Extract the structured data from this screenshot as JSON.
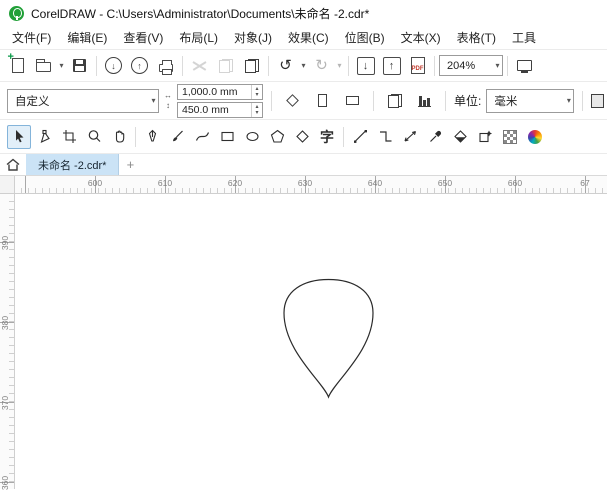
{
  "window": {
    "title": "CorelDRAW - C:\\Users\\Administrator\\Documents\\未命名 -2.cdr*"
  },
  "menu": {
    "items": [
      "文件(F)",
      "编辑(E)",
      "查看(V)",
      "布局(L)",
      "对象(J)",
      "效果(C)",
      "位图(B)",
      "文本(X)",
      "表格(T)",
      "工具"
    ]
  },
  "standard_toolbar": {
    "zoom_level": "204%",
    "pdf_label": "PDF",
    "buttons": [
      "new-document",
      "open",
      "save",
      "open-from-cloud",
      "save-to-cloud",
      "print",
      "cut",
      "copy",
      "paste",
      "undo",
      "redo",
      "import",
      "export",
      "publish-to-pdf",
      "zoom-levels",
      "fullscreen-preview"
    ]
  },
  "property_bar": {
    "page_preset": "自定义",
    "page_width": "1,000.0 mm",
    "page_height": "450.0 mm",
    "units_label": "单位:",
    "units_value": "毫米"
  },
  "toolbox": {
    "tools": [
      "pick-tool",
      "shape-tool",
      "crop-tool",
      "zoom-tool",
      "pan-tool",
      "freehand-tool",
      "artistic-media-tool",
      "bezier-tool",
      "rectangle-tool",
      "ellipse-tool",
      "polygon-tool",
      "common-shapes-tool",
      "text-tool",
      "line-tool",
      "connector-tool",
      "dimension-tool",
      "eyedropper-tool",
      "interactive-fill-tool",
      "smart-fill-tool",
      "transparency-tool",
      "more-tools"
    ],
    "active_tool": "pick-tool"
  },
  "doc_tabs": {
    "active_tab": "未命名 -2.cdr*",
    "new_tab_label": "+"
  },
  "rulers": {
    "h_labels": [
      "600",
      "610",
      "620",
      "630",
      "640",
      "650",
      "660",
      "67"
    ],
    "v_labels": [
      "390",
      "380",
      "370",
      "360"
    ]
  },
  "icons": {
    "dropdown_arrow": "▾",
    "spinner_up": "▴",
    "spinner_down": "▾",
    "undo_glyph": "↺",
    "redo_glyph": "↻",
    "down_arrow": "↓",
    "up_arrow": "↑",
    "plus": "+",
    "width_arrow": "↔",
    "height_arrow": "↕",
    "text_tool_glyph": "字",
    "home": "house-shape",
    "logo": "green-balloon"
  },
  "canvas": {
    "object": "teardrop-outline-shape",
    "stroke_color": "#2b2b2b",
    "fill": "none"
  },
  "colors": {
    "logo_green": "#21a038",
    "tab_active_bg": "#cbe3f6",
    "toolbar_bg": "#ffffff"
  }
}
